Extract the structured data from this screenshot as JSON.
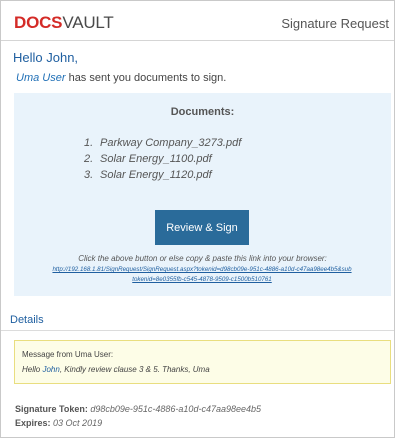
{
  "header": {
    "logo_docs": "DOCS",
    "logo_vault": "VAULT",
    "title": "Signature Request"
  },
  "greeting": "Hello John,",
  "intro": {
    "sender": "Uma User",
    "text": " has sent you documents to sign."
  },
  "documents": {
    "title": "Documents:",
    "items": [
      {
        "num": "1.",
        "name": "Parkway Company_3273.pdf"
      },
      {
        "num": "2.",
        "name": "Solar Energy_1100.pdf"
      },
      {
        "num": "3.",
        "name": "Solar Energy_1120.pdf"
      }
    ],
    "button_label": "Review & Sign",
    "copy_note": "Click the above button or else copy & paste this link into your browser:",
    "link": "http://192.168.1.81/SignRequest/SignRequest.aspx?tokenid=d98cb09e-951c-4886-a10d-c47aa98ee4b5&subtokenid=8e0355fb-c545-4878-9509-c1500b510761"
  },
  "details": {
    "label": "Details",
    "message_from": "Message from Uma User:",
    "message_prefix": "Hello ",
    "message_name": "John",
    "message_suffix": ", Kindly review clause 3 & 5. Thanks, Uma",
    "token_label": "Signature Token:",
    "token_value": "d98cb09e-951c-4886-a10d-c47aa98ee4b5",
    "expires_label": "Expires:",
    "expires_value": "03 Oct 2019"
  },
  "colors": {
    "brand_red": "#d42b27",
    "link_blue": "#1f5fa0",
    "button_blue": "#2a6b9a",
    "doc_bg": "#e9f3fb",
    "note_bg": "#fdfde7"
  }
}
